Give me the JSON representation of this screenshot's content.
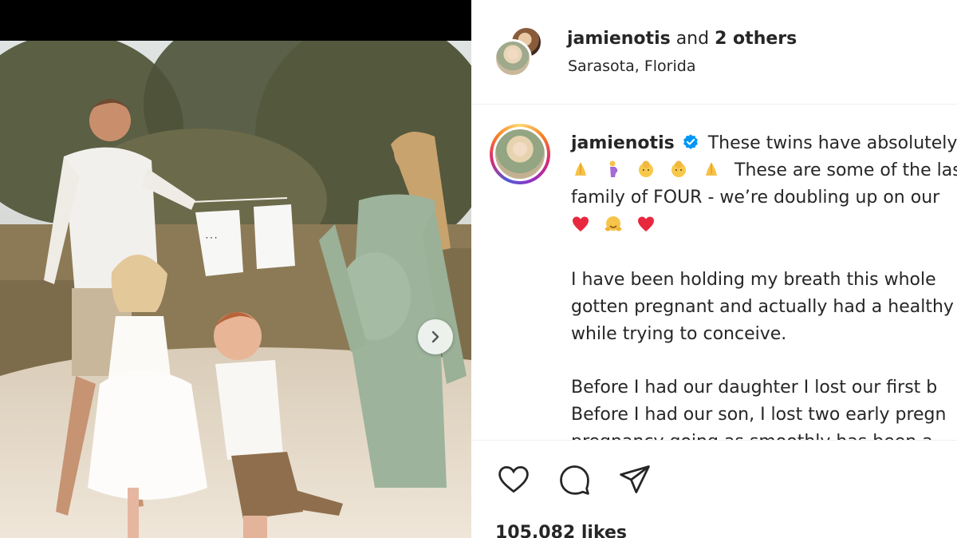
{
  "header": {
    "owner": "jamienotis",
    "and_word": "and",
    "others": "2 others",
    "location": "Sarasota, Florida"
  },
  "caption": {
    "username": "jamienotis",
    "lines": [
      "These twins have absolutely",
      "These are some of the last",
      "family of FOUR - we’re doubling up on our",
      "",
      "I have been holding my breath this whole",
      "gotten pregnant and actually had a healthy",
      "while trying to conceive.",
      "Before I had our daughter I lost our first b",
      "Before I had our son, I lost two early pregn",
      "pregnancy going as smoothly has been a"
    ],
    "emoji_row_1": [
      "praying-hands",
      "pregnant-person",
      "baby",
      "baby",
      "praying-hands"
    ],
    "emoji_row_2": [
      "red-heart",
      "hugging-face",
      "red-heart"
    ]
  },
  "likes": "105,082 likes",
  "colors": {
    "text": "#262626",
    "verified": "#0095f6",
    "divider": "#efefef",
    "heart": "#e8283f"
  },
  "icons": {
    "next": "chevron-right-icon",
    "like": "heart-outline-icon",
    "comment": "comment-bubble-icon",
    "share": "paper-plane-icon",
    "verified": "verified-badge-icon"
  }
}
